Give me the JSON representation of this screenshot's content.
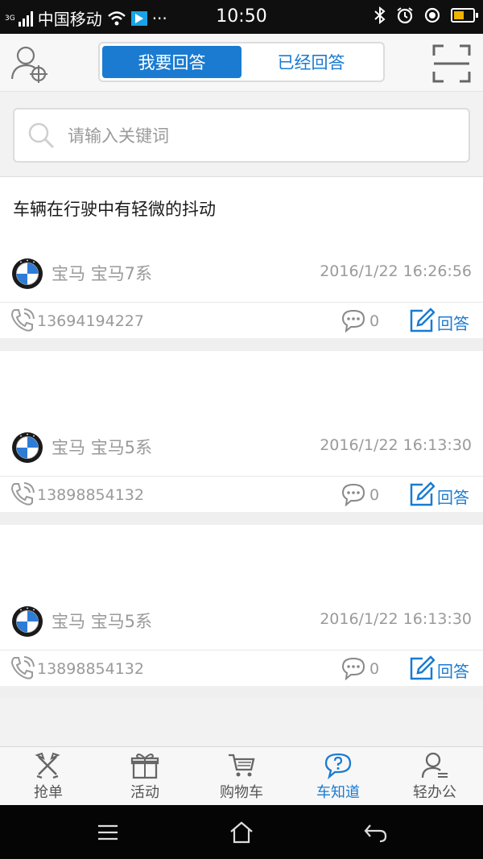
{
  "status": {
    "network": "3G",
    "carrier": "中国移动",
    "dots": "···",
    "time": "10:50"
  },
  "header": {
    "tabs": [
      {
        "label": "我要回答",
        "active": true
      },
      {
        "label": "已经回答",
        "active": false
      }
    ]
  },
  "search": {
    "placeholder": "请输入关键词"
  },
  "colors": {
    "accent": "#1a7bd1",
    "muted": "#9a9a9a"
  },
  "questions": [
    {
      "title": "车辆在行驶中有轻微的抖动",
      "brand": "宝马",
      "model": "宝马7系",
      "time": "2016/1/22 16:26:56",
      "phone": "13694194227",
      "comments": "0",
      "answer_label": "回答"
    },
    {
      "title": "",
      "brand": "宝马",
      "model": "宝马5系",
      "time": "2016/1/22 16:13:30",
      "phone": "13898854132",
      "comments": "0",
      "answer_label": "回答"
    },
    {
      "title": "",
      "brand": "宝马",
      "model": "宝马5系",
      "time": "2016/1/22 16:13:30",
      "phone": "13898854132",
      "comments": "0",
      "answer_label": "回答"
    }
  ],
  "bottom_nav": [
    {
      "label": "抢单",
      "icon": "grab-order-icon",
      "active": false
    },
    {
      "label": "活动",
      "icon": "gift-icon",
      "active": false
    },
    {
      "label": "购物车",
      "icon": "cart-icon",
      "active": false
    },
    {
      "label": "车知道",
      "icon": "question-bubble-icon",
      "active": true
    },
    {
      "label": "轻办公",
      "icon": "office-user-icon",
      "active": false
    }
  ]
}
